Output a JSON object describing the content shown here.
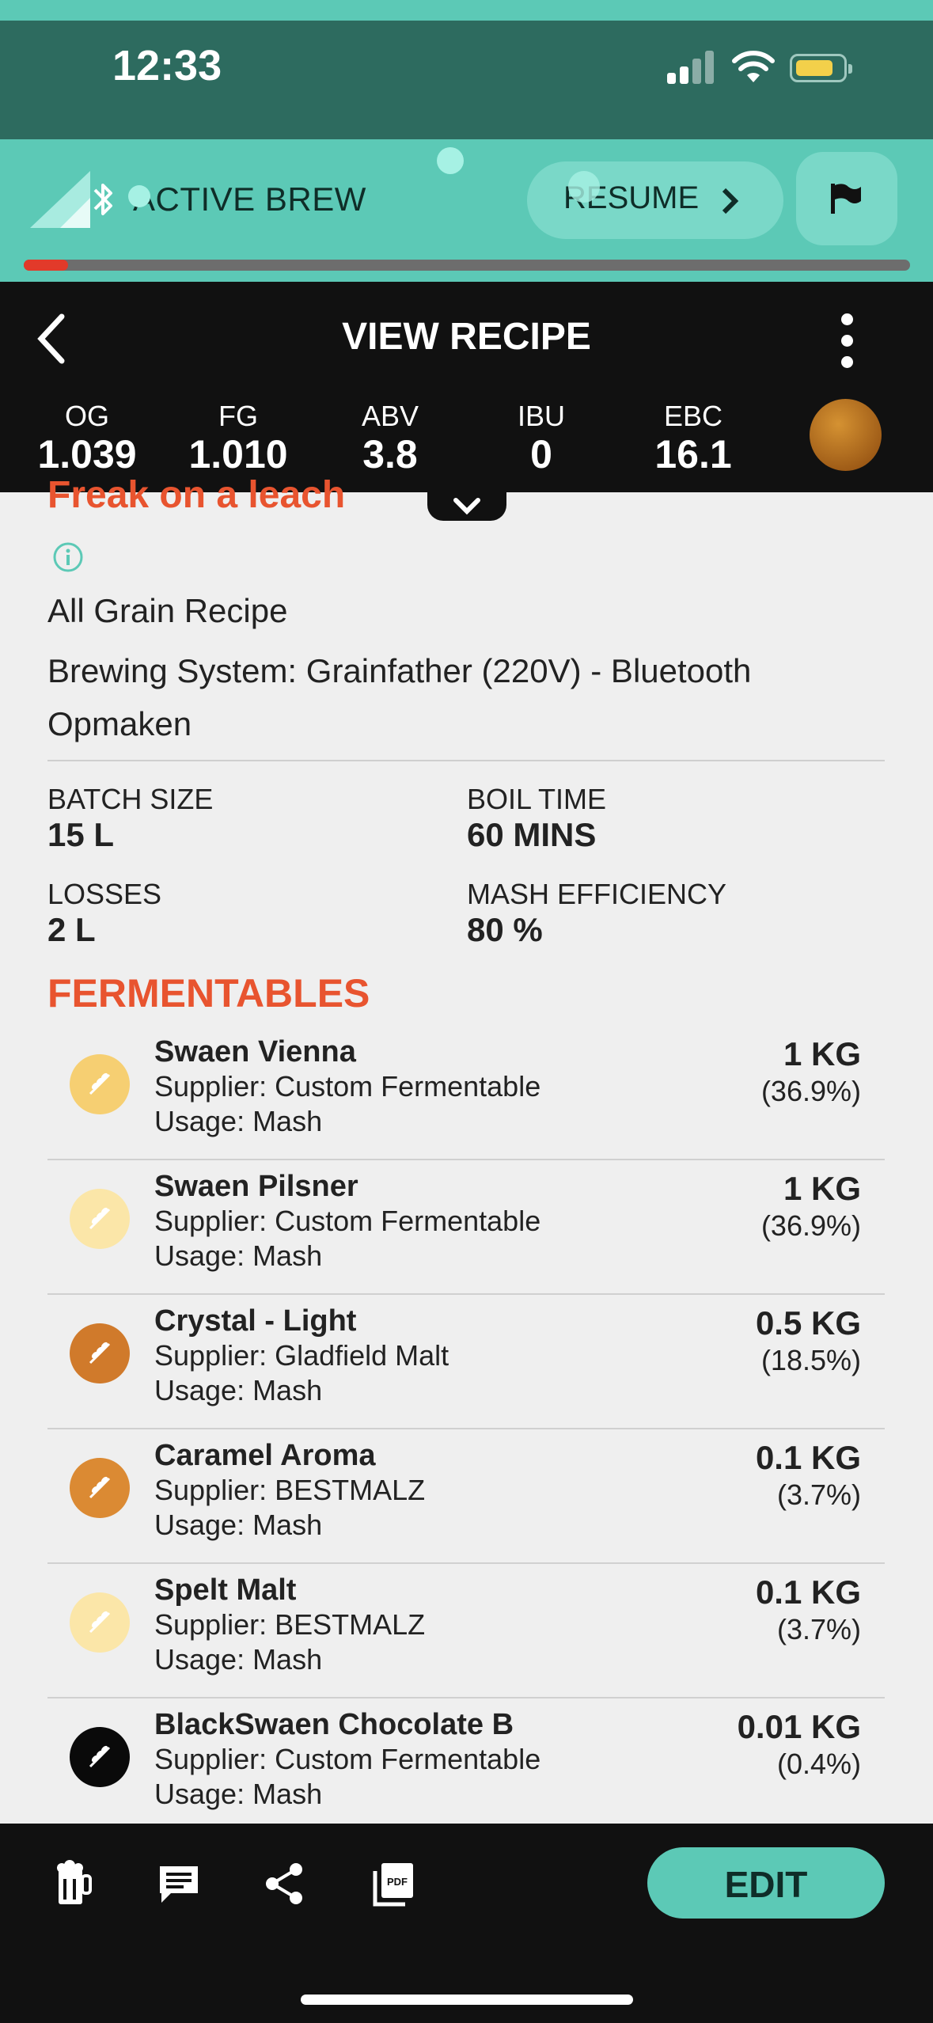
{
  "status": {
    "time": "12:33"
  },
  "active_brew": {
    "label": "ACTIVE BREW",
    "resume_label": "RESUME",
    "progress": 0.05
  },
  "header": {
    "title": "VIEW RECIPE",
    "stats": [
      {
        "key": "OG",
        "value": "1.039"
      },
      {
        "key": "FG",
        "value": "1.010"
      },
      {
        "key": "ABV",
        "value": "3.8"
      },
      {
        "key": "IBU",
        "value": "0"
      },
      {
        "key": "EBC",
        "value": "16.1"
      }
    ],
    "beer_color": "#b8721f"
  },
  "recipe": {
    "name": "Freak on a leach",
    "type": "All Grain Recipe",
    "brewing_system": "Brewing System: Grainfather (220V) - Bluetooth Opmaken",
    "params": [
      {
        "key": "BATCH SIZE",
        "value": "15 L"
      },
      {
        "key": "BOIL TIME",
        "value": "60 MINS"
      },
      {
        "key": "LOSSES",
        "value": "2 L"
      },
      {
        "key": "MASH EFFICIENCY",
        "value": "80 %"
      }
    ]
  },
  "fermentables": {
    "title": "FERMENTABLES",
    "items": [
      {
        "name": "Swaen Vienna",
        "supplier": "Supplier: Custom Fermentable",
        "usage": "Usage: Mash",
        "amount": "1 KG",
        "percent": "(36.9%)",
        "color": "#f6cf72"
      },
      {
        "name": "Swaen Pilsner",
        "supplier": "Supplier: Custom Fermentable",
        "usage": "Usage: Mash",
        "amount": "1 KG",
        "percent": "(36.9%)",
        "color": "#fbe6a8"
      },
      {
        "name": "Crystal - Light",
        "supplier": "Supplier: Gladfield Malt",
        "usage": "Usage: Mash",
        "amount": "0.5 KG",
        "percent": "(18.5%)",
        "color": "#d07a2b"
      },
      {
        "name": "Caramel Aroma",
        "supplier": "Supplier: BESTMALZ",
        "usage": "Usage: Mash",
        "amount": "0.1 KG",
        "percent": "(3.7%)",
        "color": "#db8a33"
      },
      {
        "name": "Spelt Malt",
        "supplier": "Supplier: BESTMALZ",
        "usage": "Usage: Mash",
        "amount": "0.1 KG",
        "percent": "(3.7%)",
        "color": "#fbe6a8"
      },
      {
        "name": "BlackSwaen Chocolate B",
        "supplier": "Supplier: Custom Fermentable",
        "usage": "Usage: Mash",
        "amount": "0.01 KG",
        "percent": "(0.4%)",
        "color": "#0a0a0a"
      }
    ]
  },
  "toolbar": {
    "icons": [
      "brew-icon",
      "notes-icon",
      "share-icon",
      "pdf-icon"
    ],
    "edit_label": "EDIT"
  },
  "colors": {
    "accent": "#5cc9b6",
    "brand_orange": "#e8542f",
    "status_bar": "#2d6b5f",
    "progress": "#e23a2a"
  }
}
